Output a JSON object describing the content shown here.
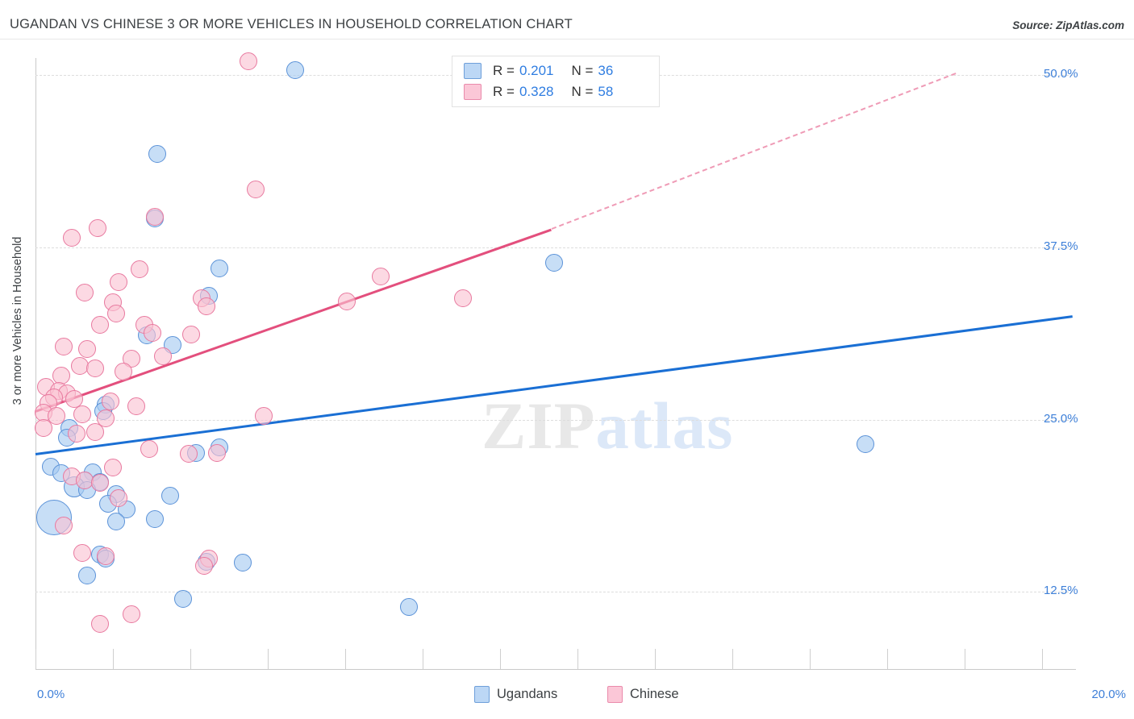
{
  "header": {
    "title": "UGANDAN VS CHINESE 3 OR MORE VEHICLES IN HOUSEHOLD CORRELATION CHART",
    "source": "Source: ZipAtlas.com"
  },
  "watermark": {
    "part1": "ZIP",
    "part2": "atlas"
  },
  "legend": {
    "rows": [
      {
        "series": "Ugandans",
        "r_prefix": "R =",
        "r_value": "0.201",
        "n_prefix": "N =",
        "n_value": "36",
        "color": "#bcd7f5"
      },
      {
        "series": "Chinese",
        "r_prefix": "R =",
        "r_value": "0.328",
        "n_prefix": "N =",
        "n_value": "58",
        "color": "#fbc7d7"
      }
    ]
  },
  "bottom_legend": [
    {
      "label": "Ugandans",
      "color": "#bcd7f5"
    },
    {
      "label": "Chinese",
      "color": "#fbc7d7"
    }
  ],
  "chart_data": {
    "type": "scatter",
    "title": "UGANDAN VS CHINESE 3 OR MORE VEHICLES IN HOUSEHOLD CORRELATION CHART",
    "xlabel": "",
    "ylabel": "3 or more Vehicles in Household",
    "xlim": [
      0.0,
      20.0
    ],
    "ylim": [
      6.9,
      51.25
    ],
    "x_tick_labels": [
      "0.0%",
      "20.0%"
    ],
    "y_tick_labels": [
      "50.0%",
      "37.5%",
      "25.0%",
      "12.5%"
    ],
    "y_tick_values": [
      50.0,
      37.5,
      25.0,
      12.5
    ],
    "grid": true,
    "legend_position": "top-center",
    "series": [
      {
        "name": "Ugandans",
        "color": "#bcd7f5",
        "edge": "#5b92d8",
        "R": 0.201,
        "N": 36,
        "trendline": {
          "x0": 0.0,
          "y0": 22.6,
          "x1": 20.0,
          "y1": 32.6,
          "style": "solid"
        },
        "points": [
          {
            "x": 5.0,
            "y": 50.4,
            "r": 11
          },
          {
            "x": 2.35,
            "y": 44.3,
            "r": 11
          },
          {
            "x": 2.3,
            "y": 39.6,
            "r": 11
          },
          {
            "x": 10.0,
            "y": 36.4,
            "r": 11
          },
          {
            "x": 3.55,
            "y": 36.0,
            "r": 11
          },
          {
            "x": 3.35,
            "y": 34.0,
            "r": 11
          },
          {
            "x": 2.15,
            "y": 31.1,
            "r": 11
          },
          {
            "x": 2.65,
            "y": 30.4,
            "r": 11
          },
          {
            "x": 1.35,
            "y": 26.1,
            "r": 11
          },
          {
            "x": 1.3,
            "y": 25.6,
            "r": 11
          },
          {
            "x": 0.65,
            "y": 24.4,
            "r": 11
          },
          {
            "x": 0.6,
            "y": 23.7,
            "r": 11
          },
          {
            "x": 3.55,
            "y": 23.0,
            "r": 11
          },
          {
            "x": 3.1,
            "y": 22.6,
            "r": 11
          },
          {
            "x": 16.0,
            "y": 23.2,
            "r": 11
          },
          {
            "x": 0.3,
            "y": 21.6,
            "r": 11
          },
          {
            "x": 0.5,
            "y": 21.1,
            "r": 11
          },
          {
            "x": 1.1,
            "y": 21.2,
            "r": 11
          },
          {
            "x": 0.95,
            "y": 20.6,
            "r": 11
          },
          {
            "x": 1.25,
            "y": 20.5,
            "r": 11
          },
          {
            "x": 0.75,
            "y": 20.1,
            "r": 13
          },
          {
            "x": 1.0,
            "y": 19.9,
            "r": 11
          },
          {
            "x": 1.55,
            "y": 19.6,
            "r": 11
          },
          {
            "x": 2.6,
            "y": 19.5,
            "r": 11
          },
          {
            "x": 1.4,
            "y": 18.9,
            "r": 11
          },
          {
            "x": 0.35,
            "y": 17.9,
            "r": 22
          },
          {
            "x": 1.75,
            "y": 18.5,
            "r": 11
          },
          {
            "x": 1.55,
            "y": 17.6,
            "r": 11
          },
          {
            "x": 2.3,
            "y": 17.8,
            "r": 11
          },
          {
            "x": 1.25,
            "y": 15.2,
            "r": 11
          },
          {
            "x": 1.35,
            "y": 14.9,
            "r": 11
          },
          {
            "x": 3.3,
            "y": 14.7,
            "r": 11
          },
          {
            "x": 4.0,
            "y": 14.6,
            "r": 11
          },
          {
            "x": 1.0,
            "y": 13.7,
            "r": 11
          },
          {
            "x": 2.85,
            "y": 12.0,
            "r": 11
          },
          {
            "x": 7.2,
            "y": 11.4,
            "r": 11
          }
        ]
      },
      {
        "name": "Chinese",
        "color": "#fbc7d7",
        "edge": "#e8799f",
        "R": 0.328,
        "N": 58,
        "trendline": {
          "x0": 0.0,
          "y0": 25.7,
          "x1": 9.95,
          "y1": 38.9,
          "style": "solid"
        },
        "trendline_extension": {
          "x0": 9.95,
          "y0": 38.9,
          "x1": 17.75,
          "y1": 50.2,
          "style": "dashed"
        },
        "points": [
          {
            "x": 4.1,
            "y": 51.0,
            "r": 11
          },
          {
            "x": 4.25,
            "y": 41.7,
            "r": 11
          },
          {
            "x": 2.3,
            "y": 39.7,
            "r": 11
          },
          {
            "x": 1.2,
            "y": 38.9,
            "r": 11
          },
          {
            "x": 0.7,
            "y": 38.2,
            "r": 11
          },
          {
            "x": 2.0,
            "y": 35.9,
            "r": 11
          },
          {
            "x": 1.6,
            "y": 35.0,
            "r": 11
          },
          {
            "x": 6.65,
            "y": 35.4,
            "r": 11
          },
          {
            "x": 0.95,
            "y": 34.2,
            "r": 11
          },
          {
            "x": 1.5,
            "y": 33.5,
            "r": 11
          },
          {
            "x": 3.2,
            "y": 33.8,
            "r": 11
          },
          {
            "x": 3.3,
            "y": 33.2,
            "r": 11
          },
          {
            "x": 6.0,
            "y": 33.6,
            "r": 11
          },
          {
            "x": 8.25,
            "y": 33.8,
            "r": 11
          },
          {
            "x": 1.55,
            "y": 32.7,
            "r": 11
          },
          {
            "x": 1.25,
            "y": 31.9,
            "r": 11
          },
          {
            "x": 2.1,
            "y": 31.9,
            "r": 11
          },
          {
            "x": 2.25,
            "y": 31.3,
            "r": 11
          },
          {
            "x": 3.0,
            "y": 31.2,
            "r": 11
          },
          {
            "x": 0.55,
            "y": 30.3,
            "r": 11
          },
          {
            "x": 1.0,
            "y": 30.1,
            "r": 11
          },
          {
            "x": 2.45,
            "y": 29.6,
            "r": 11
          },
          {
            "x": 1.85,
            "y": 29.4,
            "r": 11
          },
          {
            "x": 0.85,
            "y": 28.9,
            "r": 11
          },
          {
            "x": 1.15,
            "y": 28.7,
            "r": 11
          },
          {
            "x": 0.5,
            "y": 28.2,
            "r": 11
          },
          {
            "x": 1.7,
            "y": 28.5,
            "r": 11
          },
          {
            "x": 0.2,
            "y": 27.4,
            "r": 11
          },
          {
            "x": 0.45,
            "y": 27.1,
            "r": 11
          },
          {
            "x": 0.6,
            "y": 26.9,
            "r": 11
          },
          {
            "x": 0.35,
            "y": 26.6,
            "r": 11
          },
          {
            "x": 0.75,
            "y": 26.5,
            "r": 11
          },
          {
            "x": 0.25,
            "y": 26.2,
            "r": 11
          },
          {
            "x": 1.45,
            "y": 26.3,
            "r": 11
          },
          {
            "x": 1.95,
            "y": 26.0,
            "r": 11
          },
          {
            "x": 0.15,
            "y": 25.5,
            "r": 11
          },
          {
            "x": 0.4,
            "y": 25.3,
            "r": 11
          },
          {
            "x": 0.9,
            "y": 25.4,
            "r": 11
          },
          {
            "x": 1.35,
            "y": 25.1,
            "r": 11
          },
          {
            "x": 4.4,
            "y": 25.3,
            "r": 11
          },
          {
            "x": 0.15,
            "y": 24.4,
            "r": 11
          },
          {
            "x": 0.8,
            "y": 24.0,
            "r": 11
          },
          {
            "x": 1.15,
            "y": 24.1,
            "r": 11
          },
          {
            "x": 2.2,
            "y": 22.9,
            "r": 11
          },
          {
            "x": 3.5,
            "y": 22.6,
            "r": 11
          },
          {
            "x": 2.95,
            "y": 22.5,
            "r": 11
          },
          {
            "x": 1.5,
            "y": 21.5,
            "r": 11
          },
          {
            "x": 0.7,
            "y": 20.9,
            "r": 11
          },
          {
            "x": 0.95,
            "y": 20.6,
            "r": 11
          },
          {
            "x": 1.25,
            "y": 20.4,
            "r": 11
          },
          {
            "x": 1.6,
            "y": 19.3,
            "r": 11
          },
          {
            "x": 0.55,
            "y": 17.3,
            "r": 11
          },
          {
            "x": 0.9,
            "y": 15.3,
            "r": 11
          },
          {
            "x": 1.35,
            "y": 15.1,
            "r": 11
          },
          {
            "x": 3.35,
            "y": 14.9,
            "r": 11
          },
          {
            "x": 3.25,
            "y": 14.4,
            "r": 11
          },
          {
            "x": 1.85,
            "y": 10.9,
            "r": 11
          },
          {
            "x": 1.25,
            "y": 10.2,
            "r": 11
          }
        ]
      }
    ]
  }
}
